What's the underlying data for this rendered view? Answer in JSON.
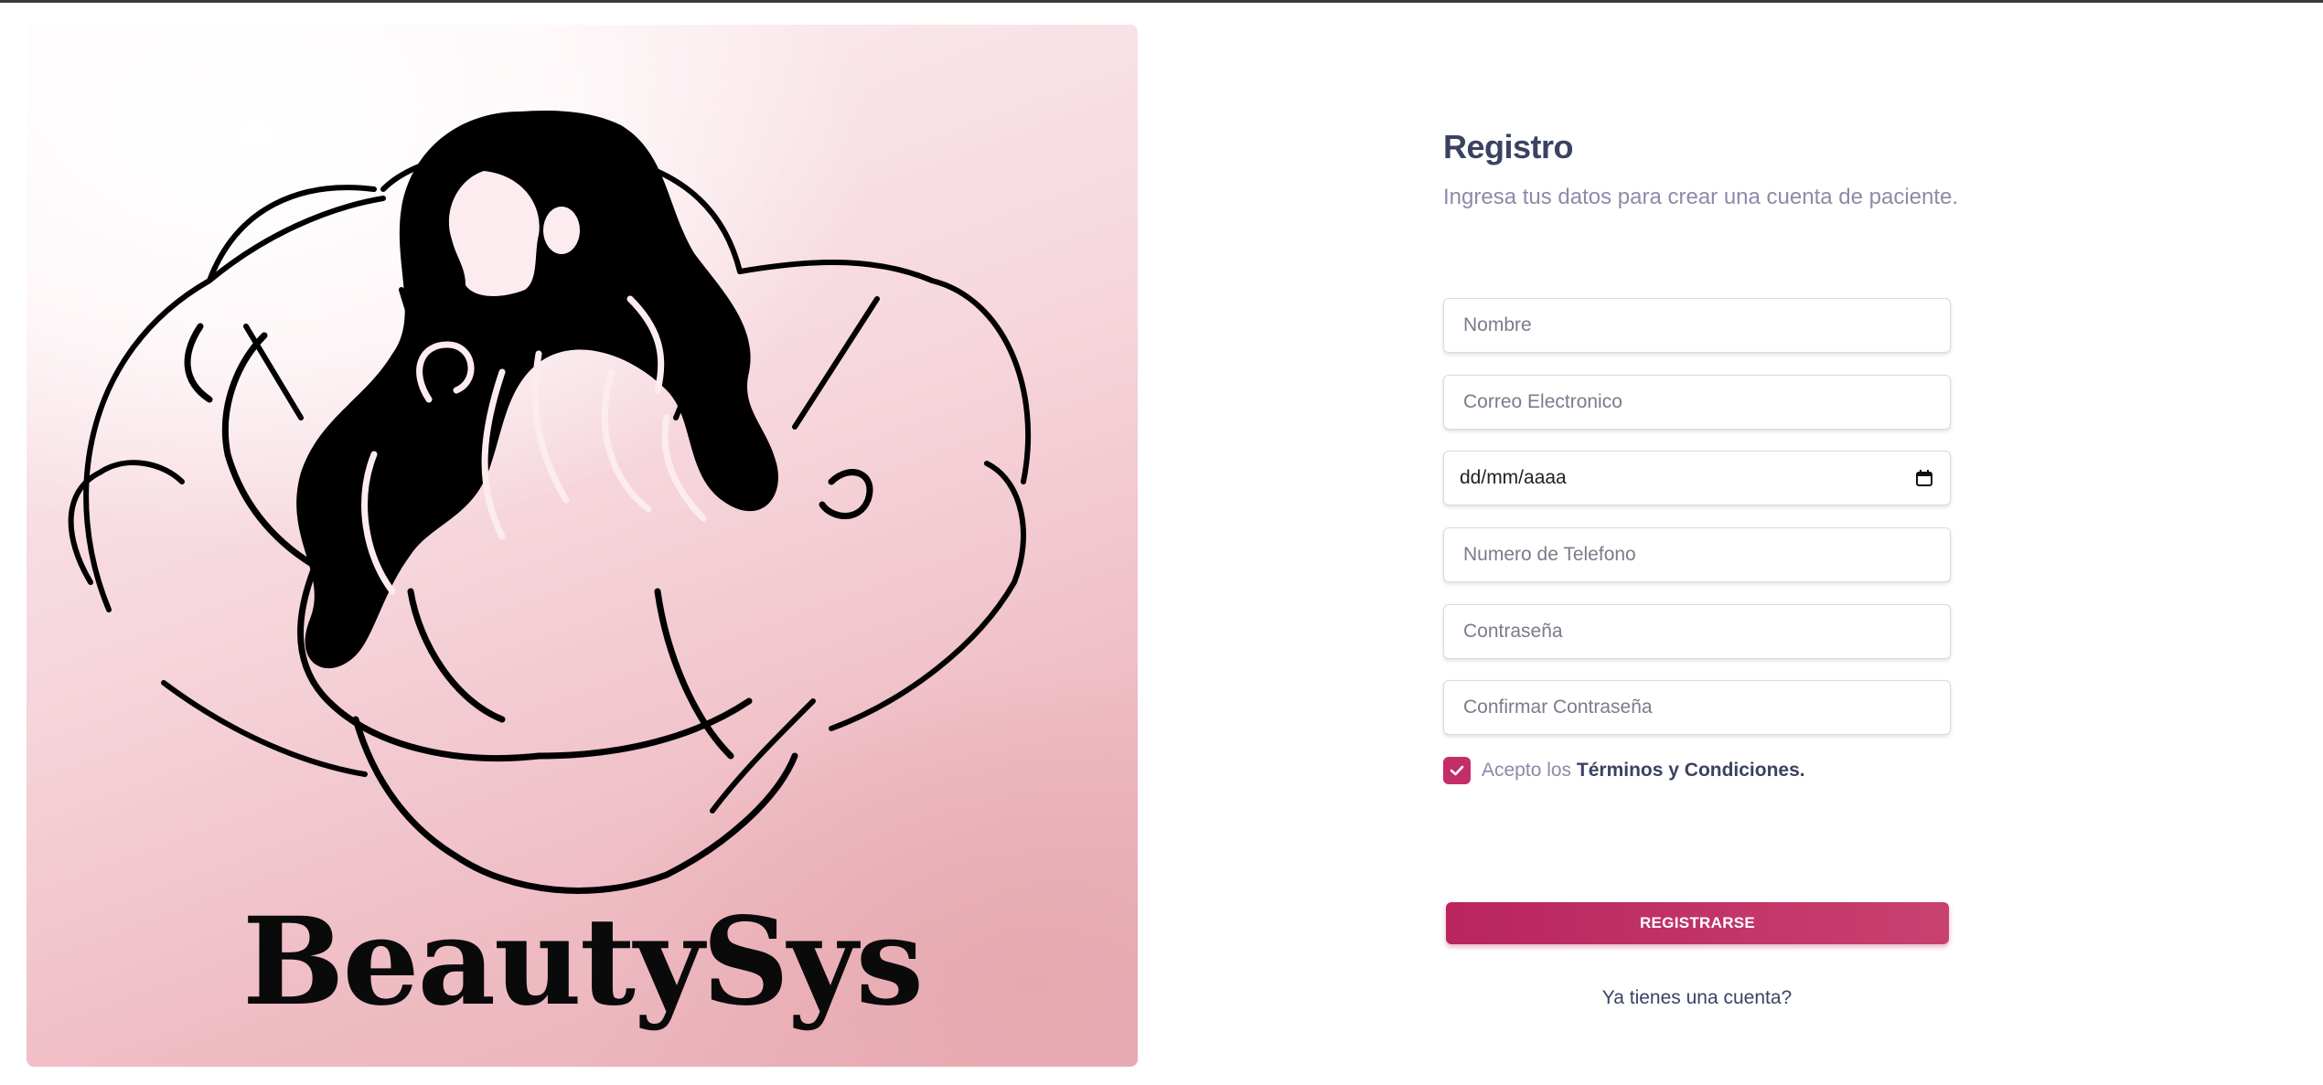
{
  "hero": {
    "brand_name": "BeautySys"
  },
  "form": {
    "title": "Registro",
    "subtitle": "Ingresa tus datos para crear una cuenta de paciente.",
    "fields": {
      "name_placeholder": "Nombre",
      "email_placeholder": "Correo Electronico",
      "birthdate_value": "dd/mm/aaaa",
      "phone_placeholder": "Numero de Telefono",
      "password_placeholder": "Contraseña",
      "confirm_password_placeholder": "Confirmar Contraseña"
    },
    "terms": {
      "checked": true,
      "prefix": "Acepto los",
      "link": "Términos y Condiciones."
    },
    "submit_label": "REGISTRARSE",
    "login_link": "Ya tienes una cuenta?"
  },
  "colors": {
    "accent": "#c22e67",
    "heading": "#3b4261",
    "muted": "#8d8aa8"
  },
  "icons": {
    "calendar": "calendar-icon",
    "check": "check-icon",
    "logo": "beauty-woman-logo"
  }
}
